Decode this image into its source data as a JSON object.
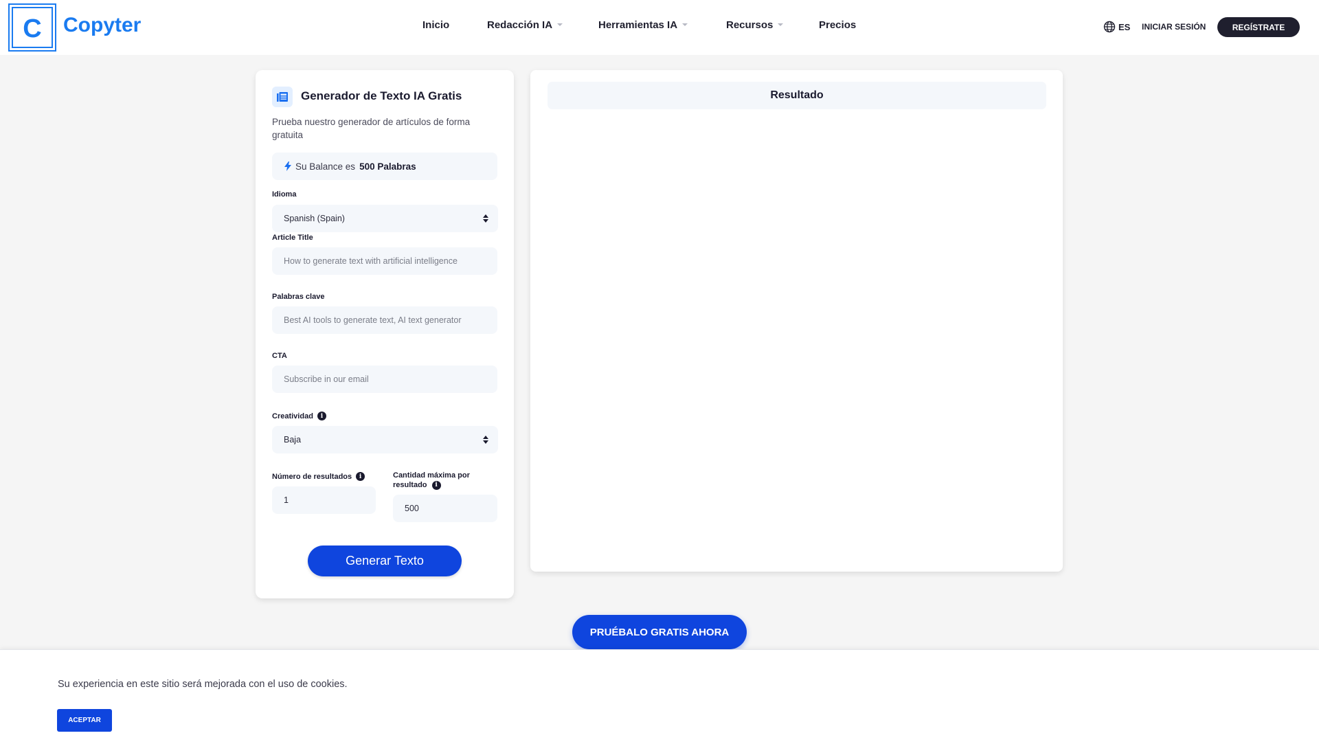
{
  "header": {
    "logo_letter": "C",
    "brand": "Copyter",
    "nav": [
      {
        "label": "Inicio",
        "has_dropdown": false
      },
      {
        "label": "Redacción IA",
        "has_dropdown": true
      },
      {
        "label": "Herramientas IA",
        "has_dropdown": true
      },
      {
        "label": "Recursos",
        "has_dropdown": true
      },
      {
        "label": "Precios",
        "has_dropdown": false
      }
    ],
    "language": "ES",
    "login_label": "INICIAR SESIÓN",
    "register_label": "REGÍSTRATE"
  },
  "form": {
    "icon": "newspaper-icon",
    "title": "Generador de Texto IA Gratis",
    "description": "Prueba nuestro generador de artículos de forma gratuita",
    "balance_prefix": "Su Balance es",
    "balance_value": "500 Palabras",
    "fields": {
      "language": {
        "label": "Idioma",
        "value": "Spanish (Spain)"
      },
      "article_title": {
        "label": "Article Title",
        "value": "",
        "placeholder": "How to generate text with artificial intelligence"
      },
      "keywords": {
        "label": "Palabras clave",
        "value": "",
        "placeholder": "Best AI tools to generate text, AI text generator"
      },
      "cta": {
        "label": "CTA",
        "value": "",
        "placeholder": "Subscribe in our email"
      },
      "creativity": {
        "label": "Creatividad",
        "value": "Baja"
      },
      "num_results": {
        "label": "Número de resultados",
        "value": "1"
      },
      "max_per_result": {
        "label": "Cantidad máxima por resultado",
        "value": "500"
      }
    },
    "generate_label": "Generar Texto"
  },
  "result": {
    "title": "Resultado"
  },
  "cta_label": "PRUÉBALO GRATIS AHORA",
  "cookie": {
    "message": "Su experiencia en este sitio será mejorada con el uso de cookies.",
    "accept_label": "ACEPTAR"
  },
  "colors": {
    "brand": "#1a7bf0",
    "primary_button": "#0f45de",
    "dark": "#1f1f2e",
    "field_bg": "#f4f7fb",
    "page_bg": "#f5f5f5"
  }
}
